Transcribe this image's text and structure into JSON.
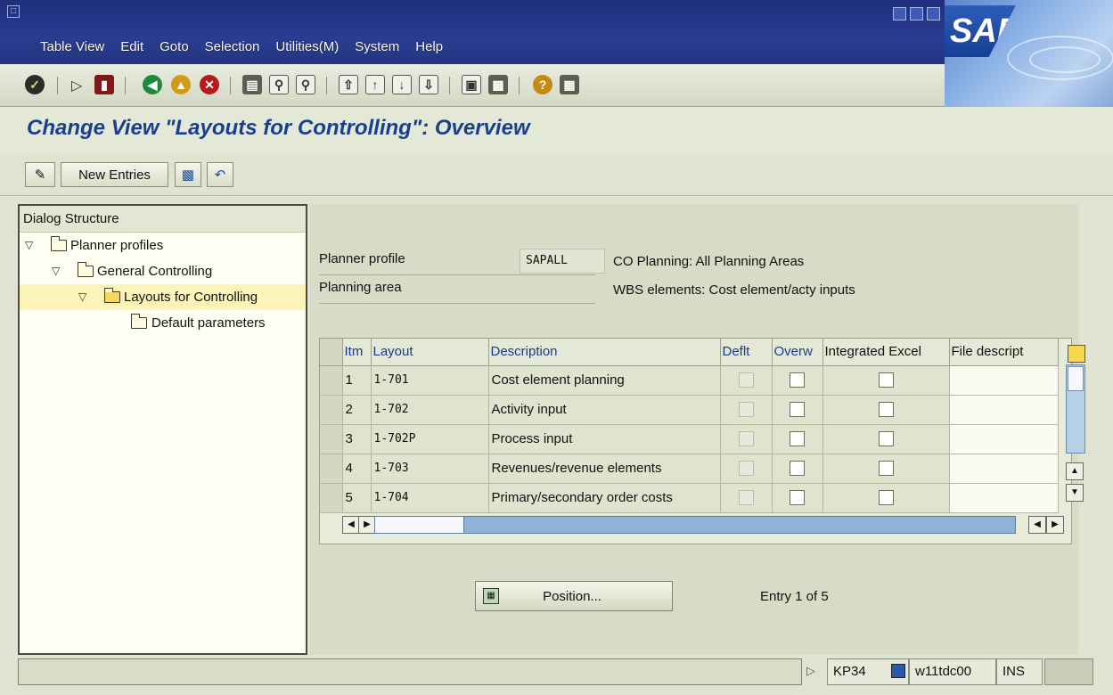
{
  "menu": [
    "Table View",
    "Edit",
    "Goto",
    "Selection",
    "Utilities(M)",
    "System",
    "Help"
  ],
  "brand": "SAP",
  "screen_title": "Change View \"Layouts for Controlling\": Overview",
  "app_toolbar": {
    "new_entries_label": "New Entries"
  },
  "tree": {
    "header": "Dialog Structure",
    "items": [
      {
        "label": "Planner profiles"
      },
      {
        "label": "General Controlling"
      },
      {
        "label": "Layouts for Controlling"
      },
      {
        "label": "Default parameters"
      }
    ]
  },
  "fields": {
    "planner_profile": {
      "label": "Planner profile",
      "value": "SAPALL",
      "desc": "CO Planning: All Planning Areas"
    },
    "planning_area": {
      "label": "Planning area",
      "value": "",
      "desc": "WBS elements: Cost element/acty inputs"
    }
  },
  "table": {
    "columns": [
      "Itm",
      "Layout",
      "Description",
      "Deflt",
      "Overw",
      "Integrated Excel",
      "File descript"
    ],
    "rows": [
      {
        "itm": "1",
        "layout": "1-701",
        "desc": "Cost element planning"
      },
      {
        "itm": "2",
        "layout": "1-702",
        "desc": "Activity input"
      },
      {
        "itm": "3",
        "layout": "1-702P",
        "desc": "Process input"
      },
      {
        "itm": "4",
        "layout": "1-703",
        "desc": "Revenues/revenue elements"
      },
      {
        "itm": "5",
        "layout": "1-704",
        "desc": "Primary/secondary order costs"
      }
    ]
  },
  "position_button": "Position...",
  "entry_info": "Entry 1 of 5",
  "status": {
    "transaction": "KP34",
    "server": "w11tdc00",
    "mode": "INS"
  }
}
